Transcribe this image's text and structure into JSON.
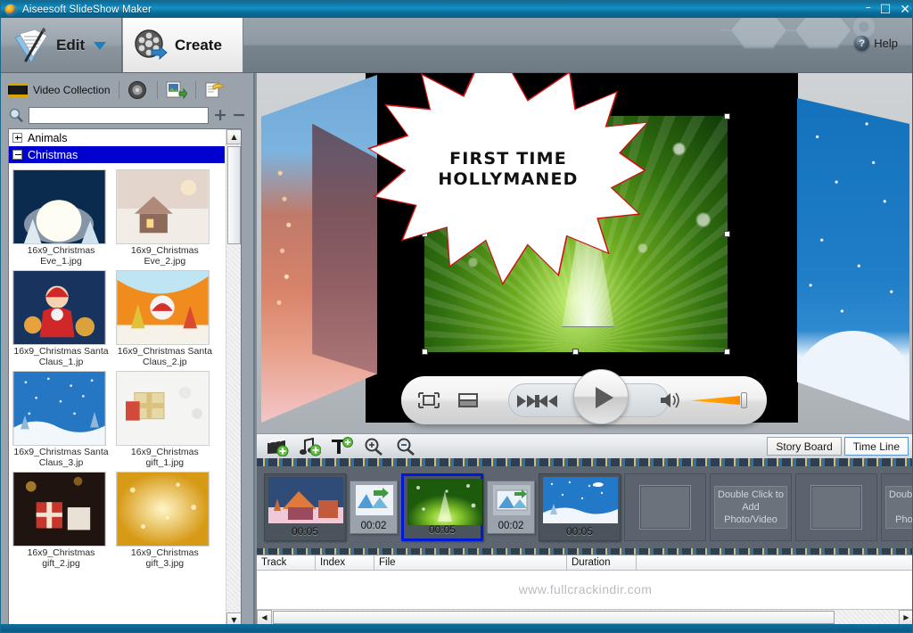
{
  "window": {
    "title": "Aiseesoft SlideShow Maker",
    "minimize": "–",
    "maximize": "☐",
    "close": "✕"
  },
  "ribbon": {
    "tabs": [
      {
        "label": "Edit",
        "icon": "edit-document-icon",
        "has_dropdown": true,
        "active": false
      },
      {
        "label": "Create",
        "icon": "film-reel-export-icon",
        "active": true
      }
    ],
    "help_label": "Help",
    "help_icon": "help-question-icon"
  },
  "library": {
    "header_label": "Video Collection",
    "header_icon": "film-strip-icon",
    "header_buttons": [
      {
        "name": "audio-collection-icon",
        "title": "Audio Collection"
      },
      {
        "name": "photo-collection-icon",
        "title": "Photo Collection"
      },
      {
        "name": "open-folder-icon",
        "title": "Open Folder"
      }
    ],
    "search": {
      "value": "",
      "placeholder": "",
      "icon": "search-icon"
    },
    "add_label": "+",
    "remove_label": "−",
    "tree": [
      {
        "label": "Animals",
        "expanded": false,
        "selected": false
      },
      {
        "label": "Christmas",
        "expanded": true,
        "selected": true
      }
    ],
    "thumbnails": [
      {
        "caption": "16x9_Christmas Eve_1.jpg"
      },
      {
        "caption": "16x9_Christmas Eve_2.jpg"
      },
      {
        "caption": "16x9_Christmas Santa Claus_1.jp"
      },
      {
        "caption": "16x9_Christmas Santa Claus_2.jp"
      },
      {
        "caption": "16x9_Christmas Santa Claus_3.jp"
      },
      {
        "caption": "16x9_Christmas gift_1.jpg"
      },
      {
        "caption": "16x9_Christmas gift_2.jpg"
      },
      {
        "caption": "16x9_Christmas gift_3.jpg"
      }
    ],
    "scroll_up": "▲",
    "scroll_down": "▼"
  },
  "preview": {
    "overlay_text_line1": "FIRST TIME",
    "overlay_text_line2": "HOLLYMANED",
    "player": {
      "fullscreen_icon": "fit-frame-icon",
      "snapshot_icon": "split-view-icon",
      "prev_icon": "previous-icon",
      "play_icon": "play-icon",
      "next_icon": "next-icon",
      "volume_icon": "speaker-icon"
    }
  },
  "timeline_toolbar": {
    "buttons": [
      {
        "name": "add-video-icon",
        "title": "Add Photo/Video"
      },
      {
        "name": "add-music-icon",
        "title": "Add Music"
      },
      {
        "name": "add-text-icon",
        "title": "Add Text"
      },
      {
        "name": "zoom-in-icon",
        "title": "Zoom In"
      },
      {
        "name": "zoom-out-icon",
        "title": "Zoom Out"
      }
    ],
    "views": [
      {
        "label": "Story Board",
        "active": false
      },
      {
        "label": "Time Line",
        "active": true
      }
    ]
  },
  "storyboard": {
    "items": [
      {
        "type": "slide",
        "duration": "00:05",
        "selected": false
      },
      {
        "type": "transition",
        "duration": "00:02"
      },
      {
        "type": "slide",
        "duration": "00:05",
        "selected": true
      },
      {
        "type": "transition",
        "duration": "00:02"
      },
      {
        "type": "slide",
        "duration": "00:05",
        "selected": false
      },
      {
        "type": "empty",
        "duration": ""
      },
      {
        "type": "add",
        "label": "Double Click to Add Photo/Video"
      },
      {
        "type": "empty",
        "duration": ""
      },
      {
        "type": "add",
        "label": "Double Click to Add Photo/Video"
      },
      {
        "type": "empty",
        "duration": ""
      }
    ]
  },
  "track_table": {
    "columns": [
      "Track",
      "Index",
      "File",
      "Duration",
      ""
    ],
    "rows": []
  },
  "watermark": "www.fullcrackindir.com",
  "scrollbars": {
    "left_arrow": "◀",
    "right_arrow": "▶"
  },
  "colors": {
    "titlebar": "#1390c4",
    "selection": "#0000cf",
    "selected_slide_border": "#0018d8",
    "accent_red": "#cc1111",
    "panel": "#9aa3ab"
  }
}
